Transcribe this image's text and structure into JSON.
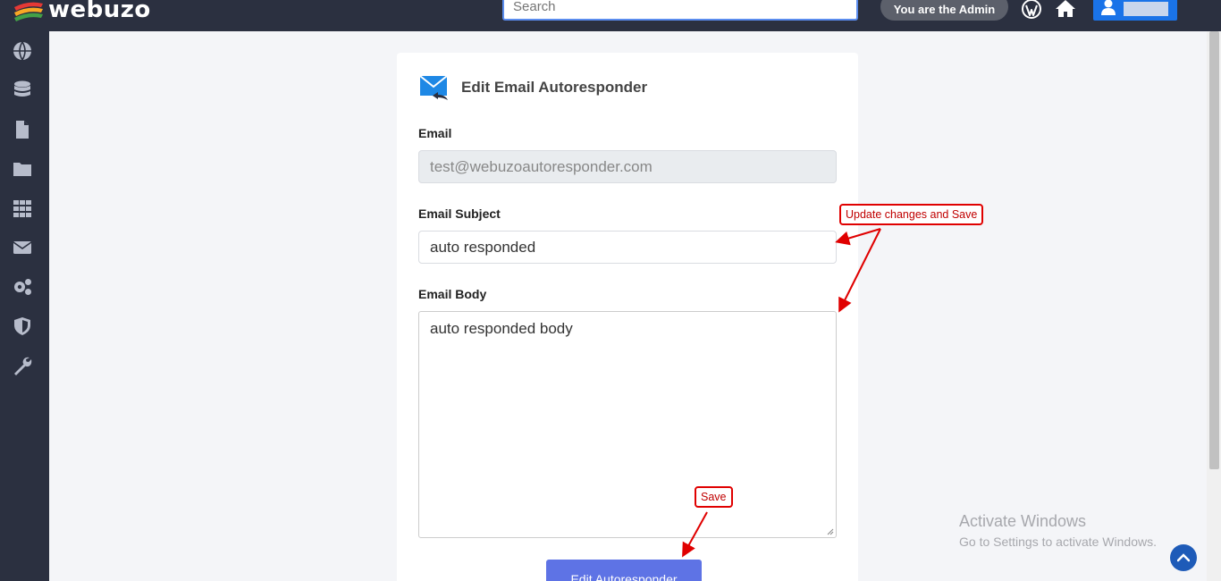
{
  "app": {
    "logo_text": "webuzo",
    "search_placeholder": "Search",
    "admin_label": "You are the Admin"
  },
  "sidebar": {
    "items": [
      {
        "name": "globe-icon"
      },
      {
        "name": "database-icon"
      },
      {
        "name": "file-icon"
      },
      {
        "name": "folder-icon"
      },
      {
        "name": "grid-icon"
      },
      {
        "name": "envelope-icon"
      },
      {
        "name": "gears-icon"
      },
      {
        "name": "shield-icon"
      },
      {
        "name": "wrench-icon"
      }
    ]
  },
  "form": {
    "title": "Edit Email Autoresponder",
    "email_label": "Email",
    "email_value": "test@webuzoautoresponder.com",
    "subject_label": "Email Subject",
    "subject_value": "auto responded",
    "body_label": "Email Body",
    "body_value": "auto responded body",
    "submit_label": "Edit Autoresponder"
  },
  "annotations": {
    "update_note": "Update changes and Save",
    "save_note": "Save"
  },
  "watermark": {
    "title": "Activate Windows",
    "subtitle": "Go to Settings to activate Windows."
  },
  "colors": {
    "topbar": "#2b3040",
    "accent": "#5e73e5",
    "annotation": "#e00000"
  }
}
